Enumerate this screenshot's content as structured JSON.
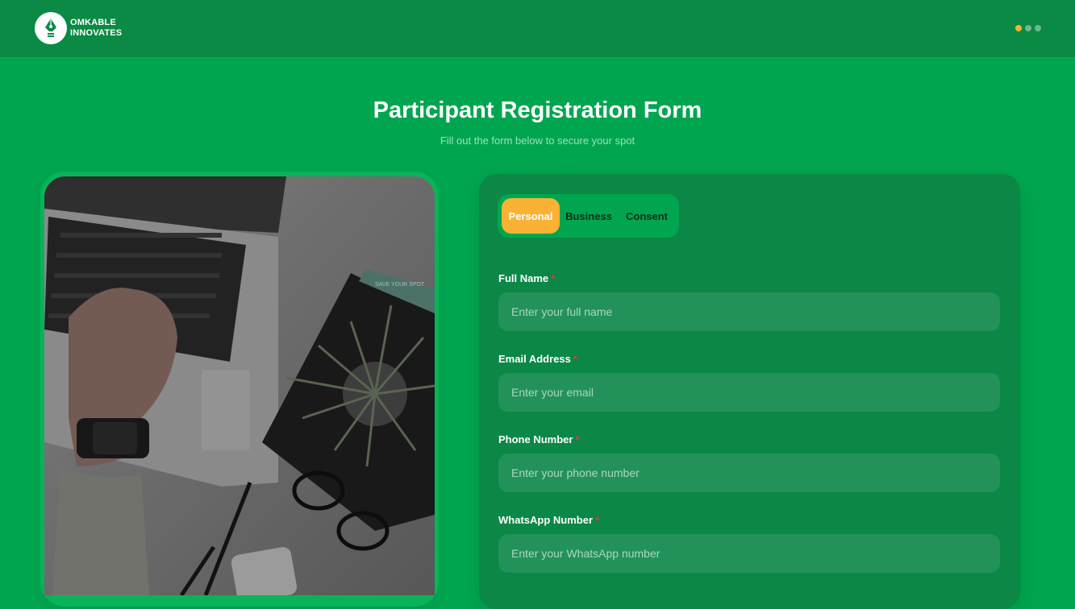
{
  "header": {
    "brand_line1": "OMKABLE",
    "brand_line2": "INNOVATES",
    "page_indicator": {
      "total": 3,
      "active_index": 0
    }
  },
  "page": {
    "title": "Participant Registration Form",
    "subtitle": "Fill out the form below to secure your spot"
  },
  "tabs": [
    {
      "label": "Personal",
      "active": true
    },
    {
      "label": "Business",
      "active": false
    },
    {
      "label": "Consent",
      "active": false
    }
  ],
  "fields": [
    {
      "label": "Full Name",
      "required": true,
      "placeholder": "Enter your full name",
      "value": ""
    },
    {
      "label": "Email Address",
      "required": true,
      "placeholder": "Enter your email",
      "value": ""
    },
    {
      "label": "Phone Number",
      "required": true,
      "placeholder": "Enter your phone number",
      "value": ""
    },
    {
      "label": "WhatsApp Number",
      "required": true,
      "placeholder": "Enter your WhatsApp number",
      "value": ""
    }
  ],
  "photo": {
    "alt_text": "",
    "notebook_tag": "SAVE YOUR SPOT"
  },
  "colors": {
    "page_bg": "#00a64f",
    "header_bg": "#0a8a44",
    "card_bg": "#0b8746",
    "accent": "#f9b233",
    "required": "#e03b3b"
  }
}
